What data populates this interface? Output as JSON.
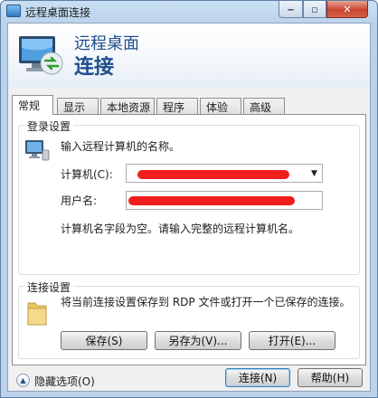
{
  "window": {
    "title": "远程桌面连接"
  },
  "header": {
    "line1": "远程桌面",
    "line2": "连接"
  },
  "tabs": [
    {
      "label": "常规"
    },
    {
      "label": "显示"
    },
    {
      "label": "本地资源"
    },
    {
      "label": "程序"
    },
    {
      "label": "体验"
    },
    {
      "label": "高级"
    }
  ],
  "login": {
    "group_title": "登录设置",
    "instruction": "输入远程计算机的名称。",
    "computer_label": "计算机(C):",
    "computer_value": "",
    "username_label": "用户名:",
    "username_value": "",
    "hint": "计算机名字段为空。请输入完整的远程计算机名。"
  },
  "connection": {
    "group_title": "连接设置",
    "description": "将当前连接设置保存到 RDP 文件或打开一个已保存的连接。",
    "save_label": "保存(S)",
    "save_as_label": "另存为(V)...",
    "open_label": "打开(E)..."
  },
  "footer": {
    "hide_options_label": "隐藏选项(O)",
    "connect_label": "连接(N)",
    "help_label": "帮助(H)"
  },
  "colors": {
    "redaction": "#f21d1d",
    "header_text": "#1f4e8c"
  }
}
